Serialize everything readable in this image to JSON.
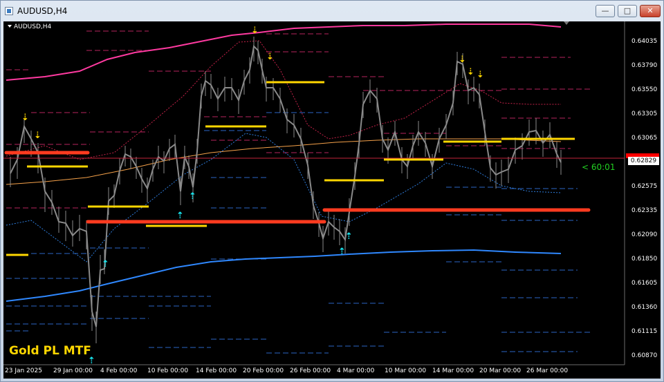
{
  "window": {
    "title": "AUDUSD,H4",
    "minimize_glyph": "—",
    "maximize_glyph": "□",
    "close_glyph": "✕",
    "icon": "chart-window-icon"
  },
  "chart": {
    "symbol_label": "AUDUSD,H4",
    "indicator_title": "Gold PL MTF",
    "countdown": "< 60:01",
    "current_price": "0.62829",
    "price_axis": [
      "0.64035",
      "0.63790",
      "0.63550",
      "0.63305",
      "0.63065",
      "0.62575",
      "0.62335",
      "0.62090",
      "0.61850",
      "0.61605",
      "0.61360",
      "0.61115",
      "0.60870"
    ],
    "time_axis": [
      "23 Jan 2025",
      "29 Jan 00:00",
      "4 Feb 00:00",
      "10 Feb 00:00",
      "14 Feb 00:00",
      "20 Feb 00:00",
      "26 Feb 00:00",
      "4 Mar 00:00",
      "10 Mar 00:00",
      "14 Mar 00:00",
      "20 Mar 00:00",
      "26 Mar 00:00"
    ],
    "colors": {
      "background": "#000000",
      "candles": "#7f7f7f",
      "magenta_band": "#ff3aa0",
      "blue_band": "#2f88ff",
      "orange_ma": "#f6a24a",
      "gold_level": "#ffd700",
      "red_level": "#ff3b1f",
      "buy_arrow": "#19e7f0",
      "sell_arrow": "#ffd700",
      "countdown": "#22d122"
    },
    "arrow_up_glyph": "⇡",
    "arrow_down_glyph": "⇣"
  }
}
